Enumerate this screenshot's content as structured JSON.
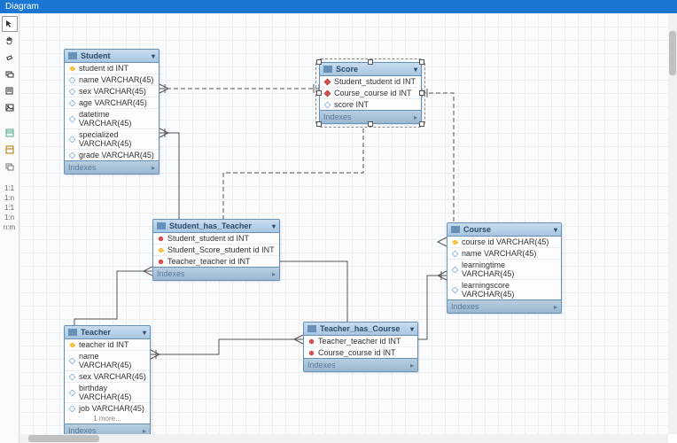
{
  "title": "Diagram",
  "indexes_label": "Indexes",
  "more_label": "1 more...",
  "toolbar_ratios": [
    "1:1",
    "1:n",
    "1:1",
    "1:n",
    "n:m"
  ],
  "entities": {
    "student": {
      "name": "Student",
      "cols": [
        {
          "icon": "key",
          "text": "student id INT"
        },
        {
          "icon": "dia",
          "text": "name VARCHAR(45)"
        },
        {
          "icon": "dia",
          "text": "sex VARCHAR(45)"
        },
        {
          "icon": "dia",
          "text": "age VARCHAR(45)"
        },
        {
          "icon": "dia",
          "text": "datetime VARCHAR(45)"
        },
        {
          "icon": "dia",
          "text": "specialized VARCHAR(45)"
        },
        {
          "icon": "dia",
          "text": "grade VARCHAR(45)"
        }
      ]
    },
    "score": {
      "name": "Score",
      "cols": [
        {
          "icon": "diaf",
          "text": "Student_student id INT"
        },
        {
          "icon": "diaf",
          "text": "Course_course id INT"
        },
        {
          "icon": "dia",
          "text": "score INT"
        }
      ]
    },
    "sht": {
      "name": "Student_has_Teacher",
      "cols": [
        {
          "icon": "pin",
          "text": "Student_student id INT"
        },
        {
          "icon": "key",
          "text": "Student_Score_student id INT"
        },
        {
          "icon": "pin",
          "text": "Teacher_teacher id INT"
        }
      ]
    },
    "course": {
      "name": "Course",
      "cols": [
        {
          "icon": "key",
          "text": "course id VARCHAR(45)"
        },
        {
          "icon": "dia",
          "text": "name VARCHAR(45)"
        },
        {
          "icon": "dia",
          "text": "learningtime VARCHAR(45)"
        },
        {
          "icon": "dia",
          "text": "learningscore VARCHAR(45)"
        }
      ]
    },
    "teacher": {
      "name": "Teacher",
      "cols": [
        {
          "icon": "key",
          "text": "teacher id INT"
        },
        {
          "icon": "dia",
          "text": "name VARCHAR(45)"
        },
        {
          "icon": "dia",
          "text": "sex VARCHAR(45)"
        },
        {
          "icon": "dia",
          "text": "birthday VARCHAR(45)"
        },
        {
          "icon": "dia",
          "text": "job VARCHAR(45)"
        }
      ]
    },
    "thc": {
      "name": "Teacher_has_Course",
      "cols": [
        {
          "icon": "pin",
          "text": "Teacher_teacher id INT"
        },
        {
          "icon": "pin",
          "text": "Course_course id INT"
        }
      ]
    }
  }
}
